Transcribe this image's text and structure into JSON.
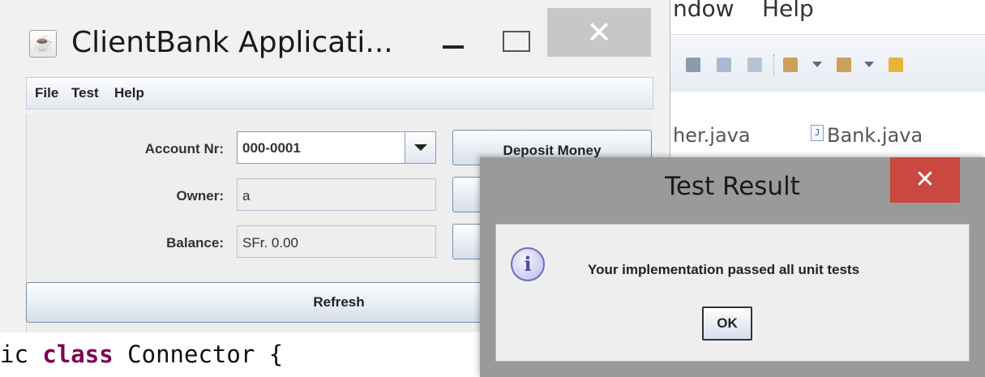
{
  "ide": {
    "menu": {
      "window_fragment": "ndow",
      "help": "Help"
    },
    "tabs": [
      {
        "label": "her.java"
      },
      {
        "label": "Bank.java"
      }
    ],
    "code": {
      "prefix": "ic ",
      "keyword": "class",
      "rest": " Connector {"
    }
  },
  "client_bank": {
    "title": "ClientBank Applicati...",
    "window_controls": {
      "close": "✕"
    },
    "menu": [
      "File",
      "Test",
      "Help"
    ],
    "account_label": "Account Nr:",
    "account_value": "000-0001",
    "owner_label": "Owner:",
    "owner_value": "a",
    "balance_label": "Balance:",
    "balance_value": "SFr. 0.00",
    "deposit_label": "Deposit Money",
    "refresh_label": "Refresh"
  },
  "dialog": {
    "title": "Test Result",
    "close": "✕",
    "message": "Your implementation passed all unit tests",
    "ok_label": "OK",
    "info_glyph": "i"
  },
  "icons": [
    "java-app-icon",
    "minimize-icon",
    "maximize-icon",
    "close-icon",
    "dropdown-arrow-icon",
    "info-icon",
    "java-file-icon"
  ],
  "colors": {
    "dialog_close": "#c9483f",
    "keyword": "#7f0055",
    "dialog_frame": "#9a9a9a"
  }
}
